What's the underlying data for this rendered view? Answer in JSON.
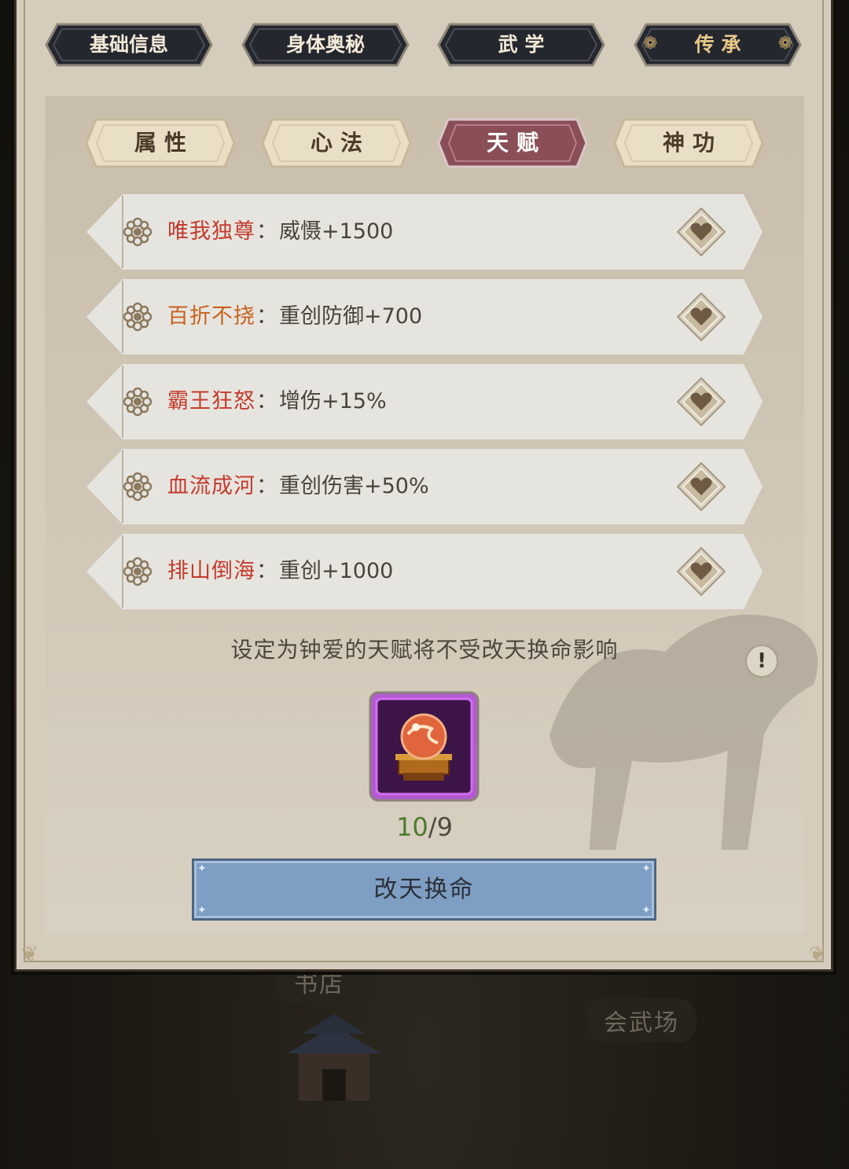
{
  "top_tabs": [
    {
      "label": "基础信息",
      "active": false
    },
    {
      "label": "身体奥秘",
      "active": false
    },
    {
      "label": "武 学",
      "active": false
    },
    {
      "label": "传 承",
      "active": true
    }
  ],
  "sub_tabs": [
    {
      "label": "属性",
      "active": false
    },
    {
      "label": "心法",
      "active": false
    },
    {
      "label": "天赋",
      "active": true
    },
    {
      "label": "神功",
      "active": false
    }
  ],
  "talents": [
    {
      "name": "唯我独尊",
      "separator": "：",
      "effect": "威慑+1500",
      "name_color": "#c43b2c"
    },
    {
      "name": "百折不挠",
      "separator": "：",
      "effect": "重创防御+700",
      "name_color": "#c9611f"
    },
    {
      "name": "霸王狂怒",
      "separator": "：",
      "effect": "增伤+15%",
      "name_color": "#c43b2c"
    },
    {
      "name": "血流成河",
      "separator": "：",
      "effect": "重创伤害+50%",
      "name_color": "#c43b2c"
    },
    {
      "name": "排山倒海",
      "separator": "：",
      "effect": "重创+1000",
      "name_color": "#c43b2c"
    }
  ],
  "hint": "设定为钟爱的天赋将不受改天换命影响",
  "info_icon": "!",
  "item": {
    "icon": "crystal-orb-icon",
    "have": "10",
    "need": "9",
    "separator": "/"
  },
  "action_button": "改天换命",
  "background_labels": {
    "left": "书店",
    "right": "会武场"
  },
  "colors": {
    "accent_active_tab": "#8a4e57",
    "button": "#7e9ec4",
    "count_have": "#4e7a2e"
  }
}
